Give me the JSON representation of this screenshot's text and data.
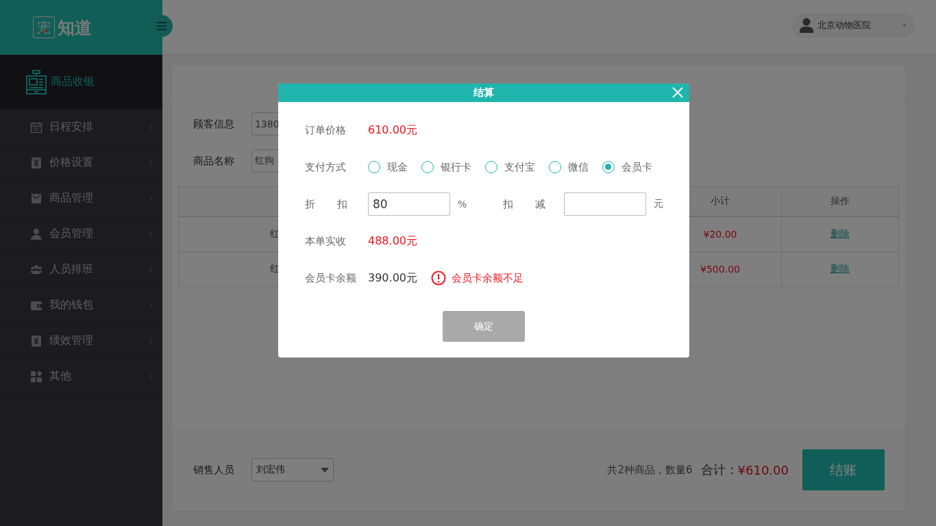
{
  "brand": {
    "logo_char": "宠",
    "name": "知道"
  },
  "sidebar": {
    "items": [
      {
        "label": "商品收银",
        "selected": true
      },
      {
        "label": "日程安排",
        "selected": false
      },
      {
        "label": "价格设置",
        "selected": false
      },
      {
        "label": "商品管理",
        "selected": false
      },
      {
        "label": "会员管理",
        "selected": false
      },
      {
        "label": "人员排班",
        "selected": false
      },
      {
        "label": "我的钱包",
        "selected": false
      },
      {
        "label": "绩效管理",
        "selected": false
      },
      {
        "label": "其他",
        "selected": false
      }
    ]
  },
  "user": {
    "name": "北京动物医院"
  },
  "form": [
    {
      "label": "顾客信息",
      "value": "1380"
    },
    {
      "label": "商品名称",
      "value": "红狗"
    }
  ],
  "table": {
    "columns": [
      "小计",
      "操作"
    ],
    "rows": [
      {
        "column_1": "红",
        "subtotal": "¥20.00",
        "action": "删除"
      },
      {
        "column_1": "红",
        "subtotal": "¥500.00",
        "action": "删除"
      }
    ]
  },
  "footer": {
    "salesperson_label": "销售人员",
    "salesperson": "刘宏伟",
    "summary": "共2种商品，数量6",
    "total_label": "合计：",
    "total": "¥610.00",
    "checkout": "结账"
  },
  "dialog": {
    "title": "结算",
    "order_price_label": "订单价格",
    "order_price": "610.00元",
    "payment_label": "支付方式",
    "payment_methods": [
      {
        "label": "现金",
        "selected": false
      },
      {
        "label": "银行卡",
        "selected": false
      },
      {
        "label": "支付宝",
        "selected": false
      },
      {
        "label": "微信",
        "selected": false
      },
      {
        "label": "会员卡",
        "selected": true
      }
    ],
    "discount_label": "折 扣",
    "discount_value": "80",
    "discount_unit": "%",
    "deduct_label": "扣 减",
    "deduct_unit": "元",
    "received_label": "本单实收",
    "received": "488.00元",
    "balance_label": "会员卡余额",
    "balance": "390.00元",
    "warning": "会员卡余额不足",
    "confirm": {
      "label": "确定",
      "disabled": true
    }
  }
}
